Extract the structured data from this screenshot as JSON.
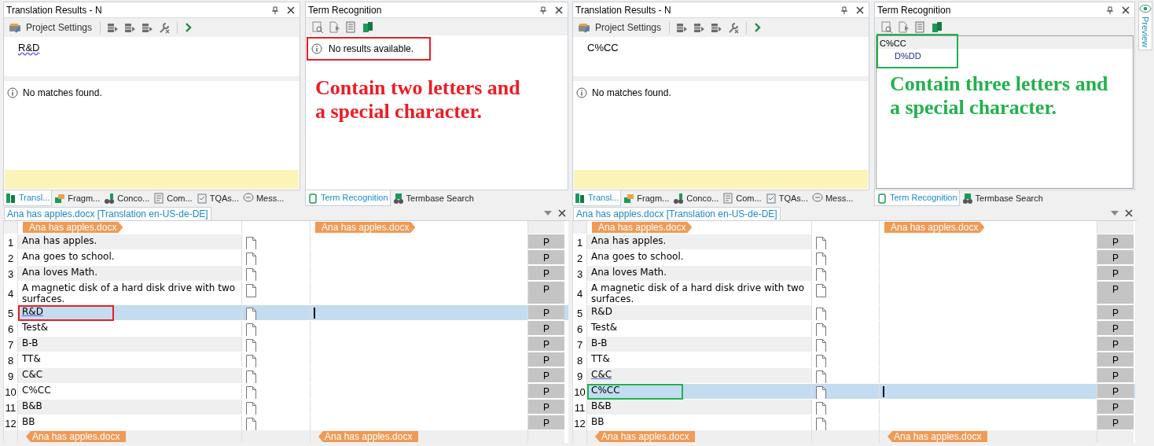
{
  "halves": [
    {
      "color": "#ed1c24",
      "translation_results": {
        "title": "Translation Results - N",
        "settings_label": "Project Settings",
        "source": "R&D",
        "source_underlined": true,
        "message": "No matches found."
      },
      "term_recognition": {
        "title": "Term Recognition",
        "message": "No results available.",
        "message_boxed": true
      },
      "annotation": "Contain two letters and a special character.",
      "results_tabs": [
        {
          "label": "Transl...",
          "selected": true
        },
        {
          "label": "Fragm...",
          "selected": false
        },
        {
          "label": "Conco...",
          "selected": false
        },
        {
          "label": "Com...",
          "selected": false
        },
        {
          "label": "TQAs...",
          "selected": false
        },
        {
          "label": "Mess...",
          "selected": false
        }
      ],
      "term_tabs": [
        {
          "label": "Term Recognition",
          "selected": true
        },
        {
          "label": "Termbase Search",
          "selected": false
        }
      ],
      "editor": {
        "tab": "Ana has apples.docx [Translation en-US-de-DE]",
        "start_tags": [
          "Ana has apples.docx",
          "Ana has apples.docx"
        ],
        "end_tags": [
          "Ana has apples.docx",
          "Ana has apples.docx"
        ],
        "rows": [
          {
            "number": "1",
            "source": "Ana has apples.",
            "status": "P",
            "selected": false,
            "underlined": false,
            "boxed": false
          },
          {
            "number": "2",
            "source": "Ana goes to school.",
            "status": "P",
            "selected": false,
            "underlined": false,
            "boxed": false
          },
          {
            "number": "3",
            "source": "Ana loves Math.",
            "status": "P",
            "selected": false,
            "underlined": false,
            "boxed": false
          },
          {
            "number": "4",
            "source": "A magnetic disk of a hard disk drive with two surfaces.",
            "status": "P",
            "selected": false,
            "underlined": false,
            "boxed": false
          },
          {
            "number": "5",
            "source": "R&D",
            "status": "P",
            "selected": true,
            "underlined": true,
            "boxed": true
          },
          {
            "number": "6",
            "source": "Test&",
            "status": "P",
            "selected": false,
            "underlined": false,
            "boxed": false
          },
          {
            "number": "7",
            "source": "B-B",
            "status": "P",
            "selected": false,
            "underlined": false,
            "boxed": false
          },
          {
            "number": "8",
            "source": "TT&",
            "status": "P",
            "selected": false,
            "underlined": false,
            "boxed": false
          },
          {
            "number": "9",
            "source": "C&C",
            "status": "P",
            "selected": false,
            "underlined": false,
            "boxed": false
          },
          {
            "number": "10",
            "source": "C%CC",
            "status": "P",
            "selected": false,
            "underlined": false,
            "boxed": false
          },
          {
            "number": "11",
            "source": "B&B",
            "status": "P",
            "selected": false,
            "underlined": false,
            "boxed": false
          },
          {
            "number": "12",
            "source": "BB",
            "status": "P",
            "selected": false,
            "underlined": false,
            "boxed": false
          }
        ]
      }
    },
    {
      "color": "#22b14c",
      "translation_results": {
        "title": "Translation Results - N",
        "settings_label": "Project Settings",
        "source": "C%CC",
        "source_underlined": false,
        "message": "No matches found."
      },
      "term_recognition": {
        "title": "Term Recognition",
        "terms_boxed": true,
        "terms": [
          {
            "source": "C%CC",
            "target": "D%DD"
          }
        ]
      },
      "annotation": "Contain three letters and a special character.",
      "results_tabs": [
        {
          "label": "Transl...",
          "selected": true
        },
        {
          "label": "Fragm...",
          "selected": false
        },
        {
          "label": "Conco...",
          "selected": false
        },
        {
          "label": "Com...",
          "selected": false
        },
        {
          "label": "TQAs...",
          "selected": false
        },
        {
          "label": "Mess...",
          "selected": false
        }
      ],
      "term_tabs": [
        {
          "label": "Term Recognition",
          "selected": true
        },
        {
          "label": "Termbase Search",
          "selected": false
        }
      ],
      "editor": {
        "tab": "Ana has apples.docx [Translation en-US-de-DE]",
        "start_tags": [
          "Ana has apples.docx",
          "Ana has apples.docx"
        ],
        "end_tags": [
          "Ana has apples.docx",
          "Ana has apples.docx"
        ],
        "rows": [
          {
            "number": "1",
            "source": "Ana has apples.",
            "status": "P",
            "selected": false,
            "underlined": false,
            "boxed": false
          },
          {
            "number": "2",
            "source": "Ana goes to school.",
            "status": "P",
            "selected": false,
            "underlined": false,
            "boxed": false
          },
          {
            "number": "3",
            "source": "Ana loves Math.",
            "status": "P",
            "selected": false,
            "underlined": false,
            "boxed": false
          },
          {
            "number": "4",
            "source": "A magnetic disk of a hard disk drive with two surfaces.",
            "status": "P",
            "selected": false,
            "underlined": false,
            "boxed": false
          },
          {
            "number": "5",
            "source": "R&D",
            "status": "P",
            "selected": false,
            "underlined": false,
            "boxed": false
          },
          {
            "number": "6",
            "source": "Test&",
            "status": "P",
            "selected": false,
            "underlined": false,
            "boxed": false
          },
          {
            "number": "7",
            "source": "B-B",
            "status": "P",
            "selected": false,
            "underlined": false,
            "boxed": false
          },
          {
            "number": "8",
            "source": "TT&",
            "status": "P",
            "selected": false,
            "underlined": false,
            "boxed": false
          },
          {
            "number": "9",
            "source": "C&C",
            "status": "P",
            "selected": false,
            "underlined": true,
            "boxed": false
          },
          {
            "number": "10",
            "source": "C%CC",
            "status": "P",
            "selected": true,
            "underlined": false,
            "boxed": true
          },
          {
            "number": "11",
            "source": "B&B",
            "status": "P",
            "selected": false,
            "underlined": false,
            "boxed": false
          },
          {
            "number": "12",
            "source": "BB",
            "status": "P",
            "selected": false,
            "underlined": false,
            "boxed": false
          }
        ]
      }
    }
  ],
  "preview_tab": "Preview"
}
